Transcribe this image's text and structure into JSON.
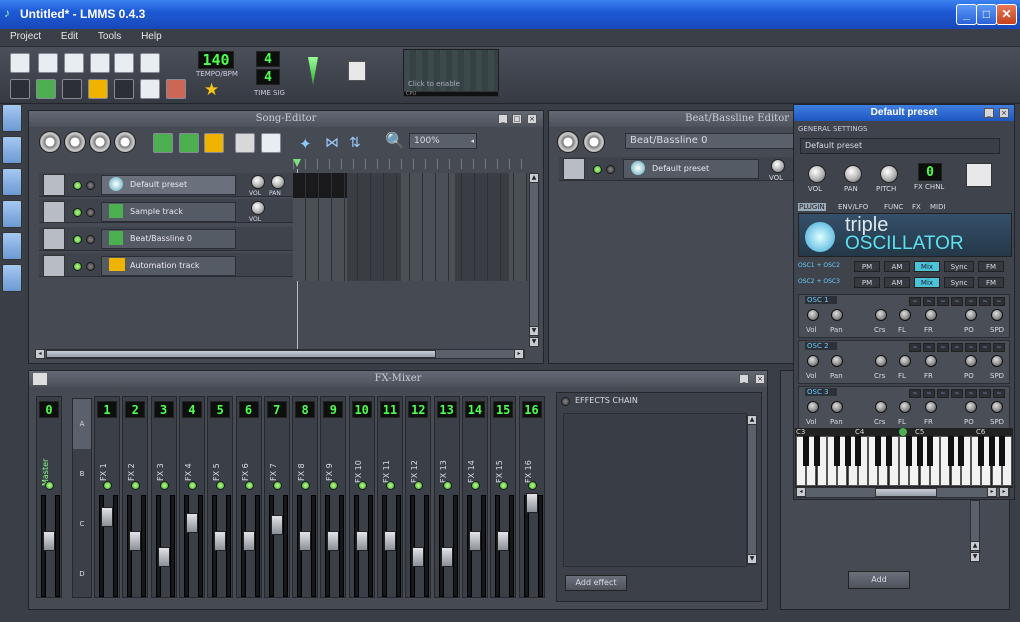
{
  "window": {
    "title": "Untitled* - LMMS 0.4.3"
  },
  "menu": [
    "Project",
    "Edit",
    "Tools",
    "Help"
  ],
  "toolbar": {
    "tempo": "140",
    "tempo_label": "TEMPO/BPM",
    "timesig_top": "4",
    "timesig_bottom": "4",
    "timesig_label": "TIME SIG",
    "visualizer_hint": "Click to enable",
    "cpu_label": "CPU"
  },
  "song_editor": {
    "title": "Song-Editor",
    "zoom": "100%",
    "tracks": [
      {
        "name": "Default preset",
        "knobs": [
          "VOL",
          "PAN"
        ]
      },
      {
        "name": "Sample track",
        "knobs": [
          "VOL"
        ]
      },
      {
        "name": "Beat/Bassline 0",
        "knobs": []
      },
      {
        "name": "Automation track",
        "knobs": []
      }
    ]
  },
  "bb_editor": {
    "title": "Beat/Bassline Editor",
    "select_value": "Beat/Bassline 0",
    "track": "Default preset",
    "vol_label": "VOL"
  },
  "fx_mixer": {
    "title": "FX-Mixer",
    "master_num": "0",
    "master_label": "Master",
    "banks": [
      "A",
      "B",
      "C",
      "D"
    ],
    "channels": [
      {
        "num": "1",
        "label": "FX 1"
      },
      {
        "num": "2",
        "label": "FX 2"
      },
      {
        "num": "3",
        "label": "FX 3"
      },
      {
        "num": "4",
        "label": "FX 4"
      },
      {
        "num": "5",
        "label": "FX 5"
      },
      {
        "num": "6",
        "label": "FX 6"
      },
      {
        "num": "7",
        "label": "FX 7"
      },
      {
        "num": "8",
        "label": "FX 8"
      },
      {
        "num": "9",
        "label": "FX 9"
      },
      {
        "num": "10",
        "label": "FX 10"
      },
      {
        "num": "11",
        "label": "FX 11"
      },
      {
        "num": "12",
        "label": "FX 12"
      },
      {
        "num": "13",
        "label": "FX 13"
      },
      {
        "num": "14",
        "label": "FX 14"
      },
      {
        "num": "15",
        "label": "FX 15"
      },
      {
        "num": "16",
        "label": "FX 16"
      }
    ],
    "effects_chain_label": "EFFECTS CHAIN",
    "add_effect": "Add effect",
    "add": "Add"
  },
  "preset": {
    "title": "Default preset",
    "general_settings": "GENERAL SETTINGS",
    "name_value": "Default preset",
    "knobs": [
      "VOL",
      "PAN",
      "PITCH"
    ],
    "fx_chnl_value": "0",
    "fx_chnl_label": "FX CHNL",
    "tabs": [
      "PLUGIN",
      "ENV/LFO",
      "FUNC",
      "FX",
      "MIDI"
    ],
    "plugin_name_1": "triple",
    "plugin_name_2": "OSCILLATOR",
    "mod_rows": [
      {
        "label": "OSC1 + OSC2",
        "modes": [
          "PM",
          "AM",
          "Mix",
          "Sync",
          "FM"
        ]
      },
      {
        "label": "OSC2 + OSC3",
        "modes": [
          "PM",
          "AM",
          "Mix",
          "Sync",
          "FM"
        ]
      }
    ],
    "oscillators": [
      "OSC 1",
      "OSC 2",
      "OSC 3"
    ],
    "osc_knobs": [
      "Vol",
      "Pan",
      "Crs",
      "FL",
      "FR",
      "PO",
      "SPD"
    ],
    "octaves": [
      "C3",
      "C4",
      "C5",
      "C6"
    ]
  }
}
